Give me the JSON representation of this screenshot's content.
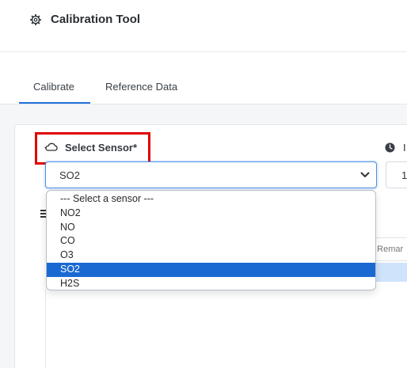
{
  "header": {
    "title": "Calibration Tool",
    "icon": "gear-icon"
  },
  "tabs": [
    {
      "label": "Calibrate",
      "active": true
    },
    {
      "label": "Reference Data",
      "active": false
    }
  ],
  "form": {
    "sensor_label": "Select Sensor*",
    "sensor_icon": "sensor-cloud-icon",
    "selected_value": "SO2",
    "right_label": "I",
    "right_value": "1",
    "highlight_color": "#e00000"
  },
  "dropdown": {
    "options": [
      "--- Select a sensor ---",
      "NO2",
      "NO",
      "CO",
      "O3",
      "SO2",
      "H2S"
    ],
    "selected_index": 5,
    "selected_color": "#1a69d3"
  },
  "table": {
    "partial_header": "n Remar"
  }
}
